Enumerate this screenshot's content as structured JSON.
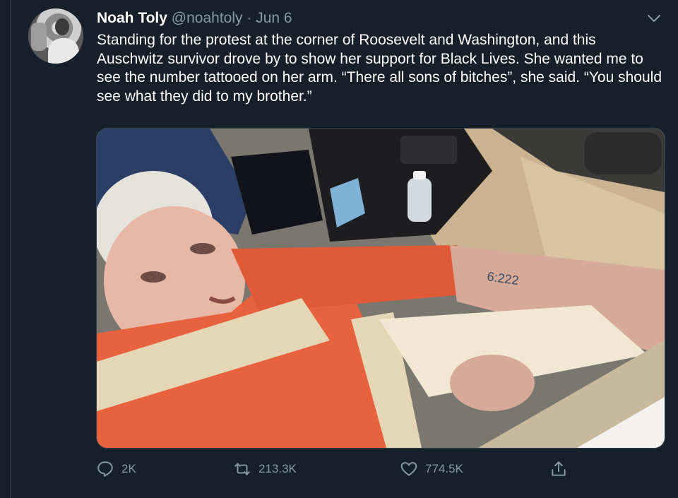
{
  "tweet": {
    "author_name": "Noah Toly",
    "handle": "@noahtoly",
    "separator": "·",
    "date": "Jun 6",
    "text": "Standing for the protest at the corner of Roosevelt and Washington, and this Auschwitz survivor drove by to show her support for Black Lives. She wanted me to see the number tattooed on her arm. “There all sons of bitches”, she said. “You should see what they did to my brother.”",
    "photo_arm_number": "6:222"
  },
  "actions": {
    "reply_count": "2K",
    "retweet_count": "213.3K",
    "like_count": "774.5K"
  },
  "icons": [
    "avatar",
    "chevron-down-icon",
    "reply-icon",
    "retweet-icon",
    "like-icon",
    "share-icon"
  ],
  "colors": {
    "background": "#15202b",
    "secondary_text": "#8899a6",
    "border": "#38444d"
  }
}
